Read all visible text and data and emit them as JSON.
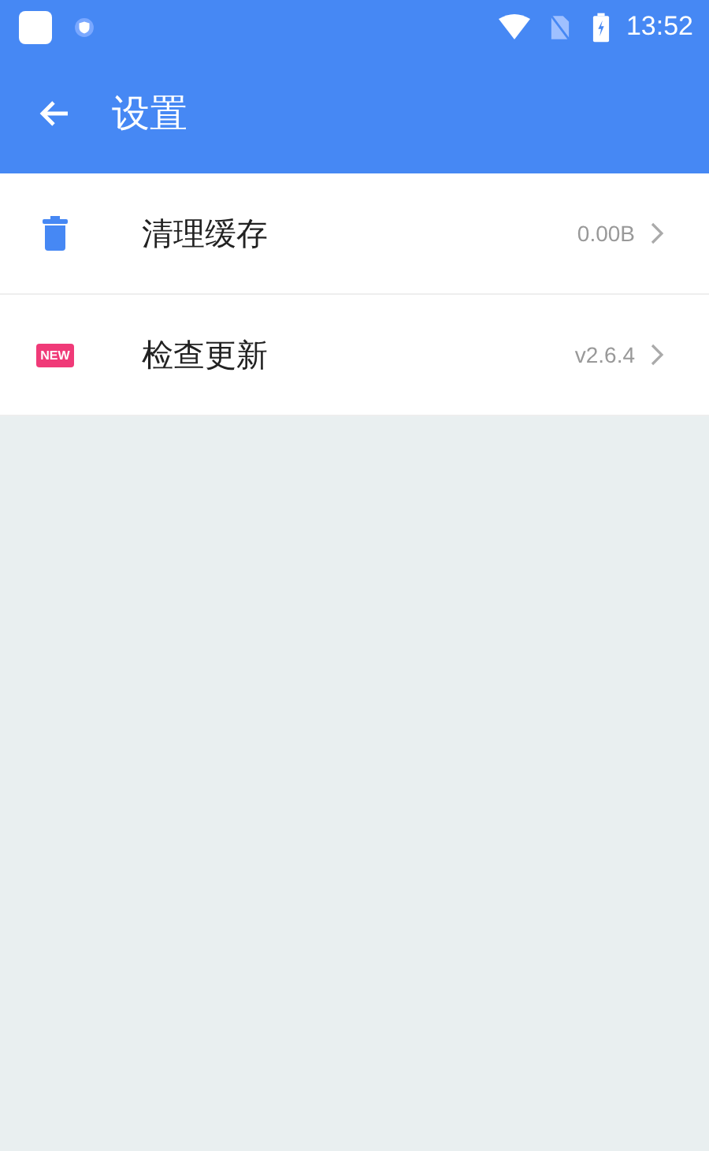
{
  "status_bar": {
    "time": "13:52"
  },
  "header": {
    "title": "设置"
  },
  "items": [
    {
      "kind": "trash",
      "label": "清理缓存",
      "value": "0.00B"
    },
    {
      "kind": "new",
      "badge": "NEW",
      "label": "检查更新",
      "value": "v2.6.4"
    }
  ]
}
